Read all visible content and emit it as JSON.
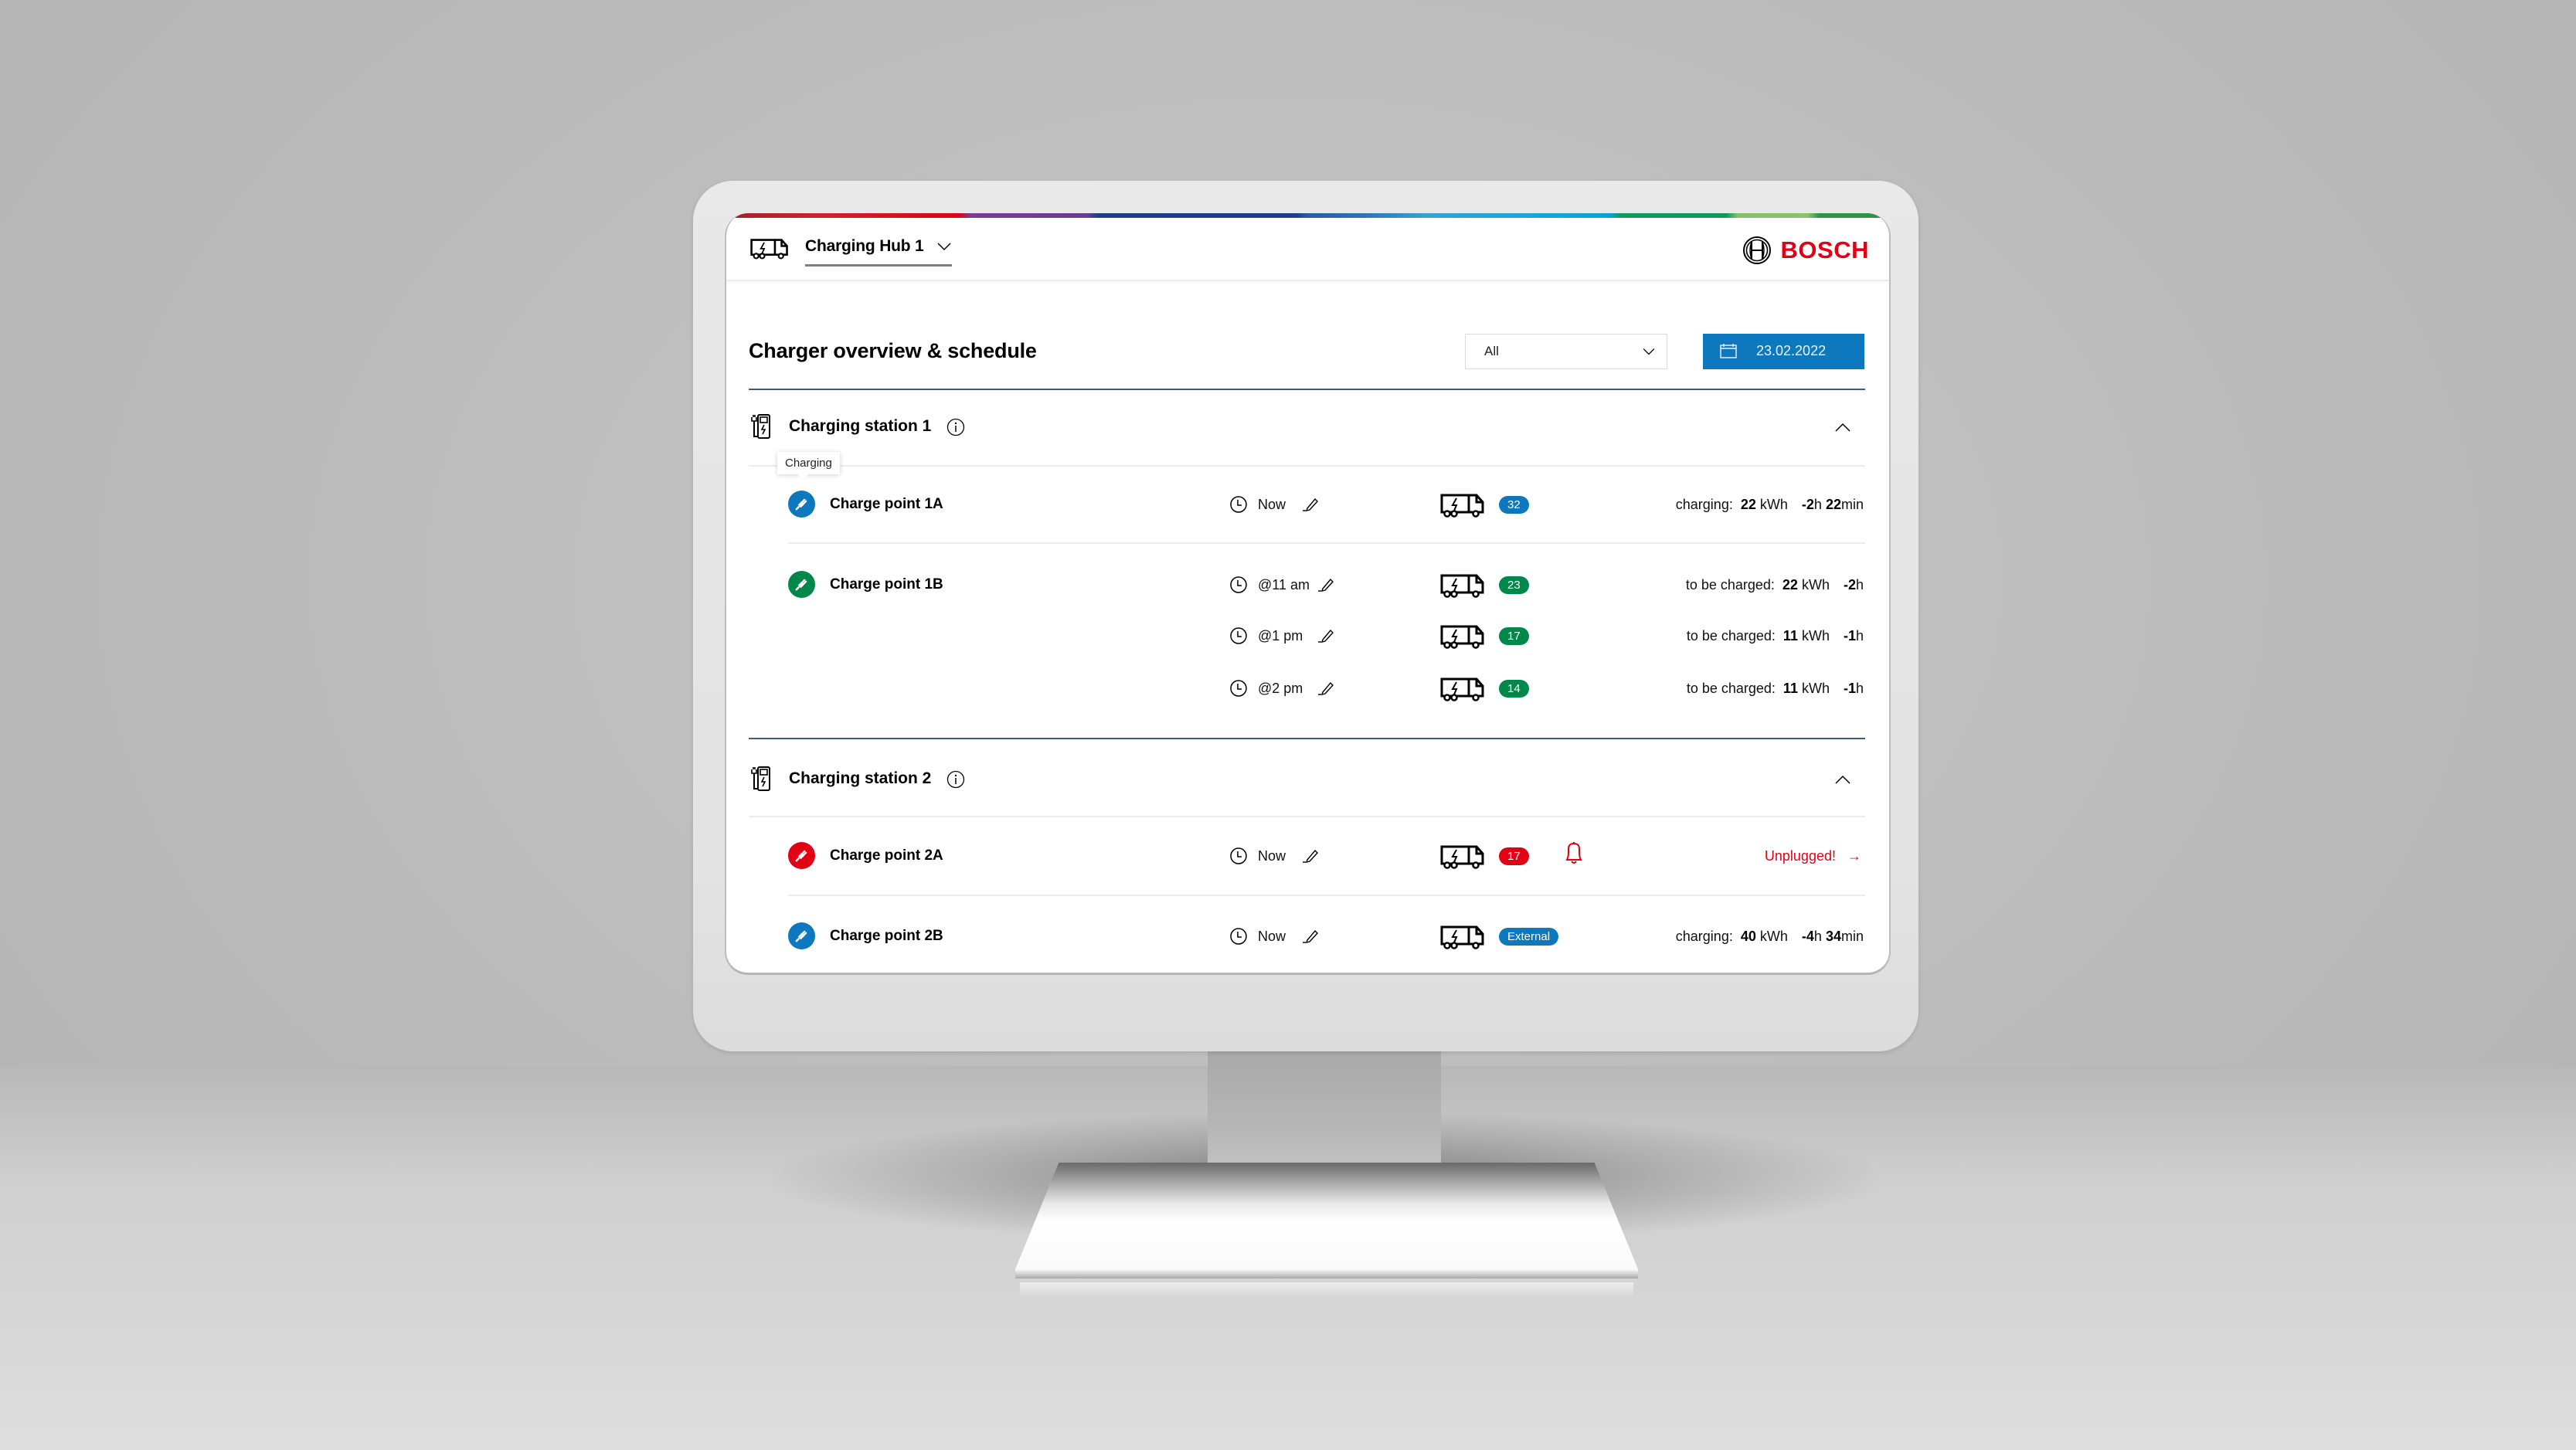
{
  "header": {
    "hub_name": "Charging Hub 1",
    "hub_icon": "electric-truck-icon",
    "brand": "BOSCH",
    "brand_color": "#e20015"
  },
  "toolbar": {
    "title": "Charger overview & schedule",
    "filter_value": "All",
    "date_label": "23.02.2022",
    "date_icon": "calendar-icon",
    "accent_color": "#0d78be"
  },
  "tooltip": {
    "text": "Charging"
  },
  "stations": [
    {
      "title": "Charging station 1",
      "charge_points": [
        {
          "name": "Charge point 1A",
          "status": "charging",
          "status_color": "#0d78be",
          "schedules": [
            {
              "time": "Now",
              "badge": "32",
              "badge_color": "#0d78be",
              "status_label": "charging:",
              "energy_value": "22",
              "energy_unit": "kWh",
              "duration_prefix": "-",
              "duration_h": "2",
              "duration_h_unit": "h",
              "duration_min": "22",
              "duration_min_unit": "min"
            }
          ]
        },
        {
          "name": "Charge point 1B",
          "status": "available",
          "status_color": "#00884a",
          "schedules": [
            {
              "time": "@11 am",
              "badge": "23",
              "badge_color": "#00884a",
              "status_label": "to be charged:",
              "energy_value": "22",
              "energy_unit": "kWh",
              "duration_prefix": "-",
              "duration_h": "2",
              "duration_h_unit": "h"
            },
            {
              "time": "@1 pm",
              "badge": "17",
              "badge_color": "#00884a",
              "status_label": "to be charged:",
              "energy_value": "11",
              "energy_unit": "kWh",
              "duration_prefix": "-",
              "duration_h": "1",
              "duration_h_unit": "h"
            },
            {
              "time": "@2 pm",
              "badge": "14",
              "badge_color": "#00884a",
              "status_label": "to be charged:",
              "energy_value": "11",
              "energy_unit": "kWh",
              "duration_prefix": "-",
              "duration_h": "1",
              "duration_h_unit": "h"
            }
          ]
        }
      ]
    },
    {
      "title": "Charging station 2",
      "charge_points": [
        {
          "name": "Charge point 2A",
          "status": "error",
          "status_color": "#e20015",
          "schedules": [
            {
              "time": "Now",
              "badge": "17",
              "badge_color": "#e20015",
              "alert_icon": "bell-icon",
              "alert_text": "Unplugged!",
              "alert_arrow": "→"
            }
          ]
        },
        {
          "name": "Charge point 2B",
          "status": "charging",
          "status_color": "#0d78be",
          "schedules": [
            {
              "time": "Now",
              "badge": "External",
              "badge_color": "#0d78be",
              "status_label": "charging:",
              "energy_value": "40",
              "energy_unit": "kWh",
              "duration_prefix": "-",
              "duration_h": "4",
              "duration_h_unit": "h",
              "duration_min": "34",
              "duration_min_unit": "min"
            }
          ]
        }
      ]
    }
  ]
}
